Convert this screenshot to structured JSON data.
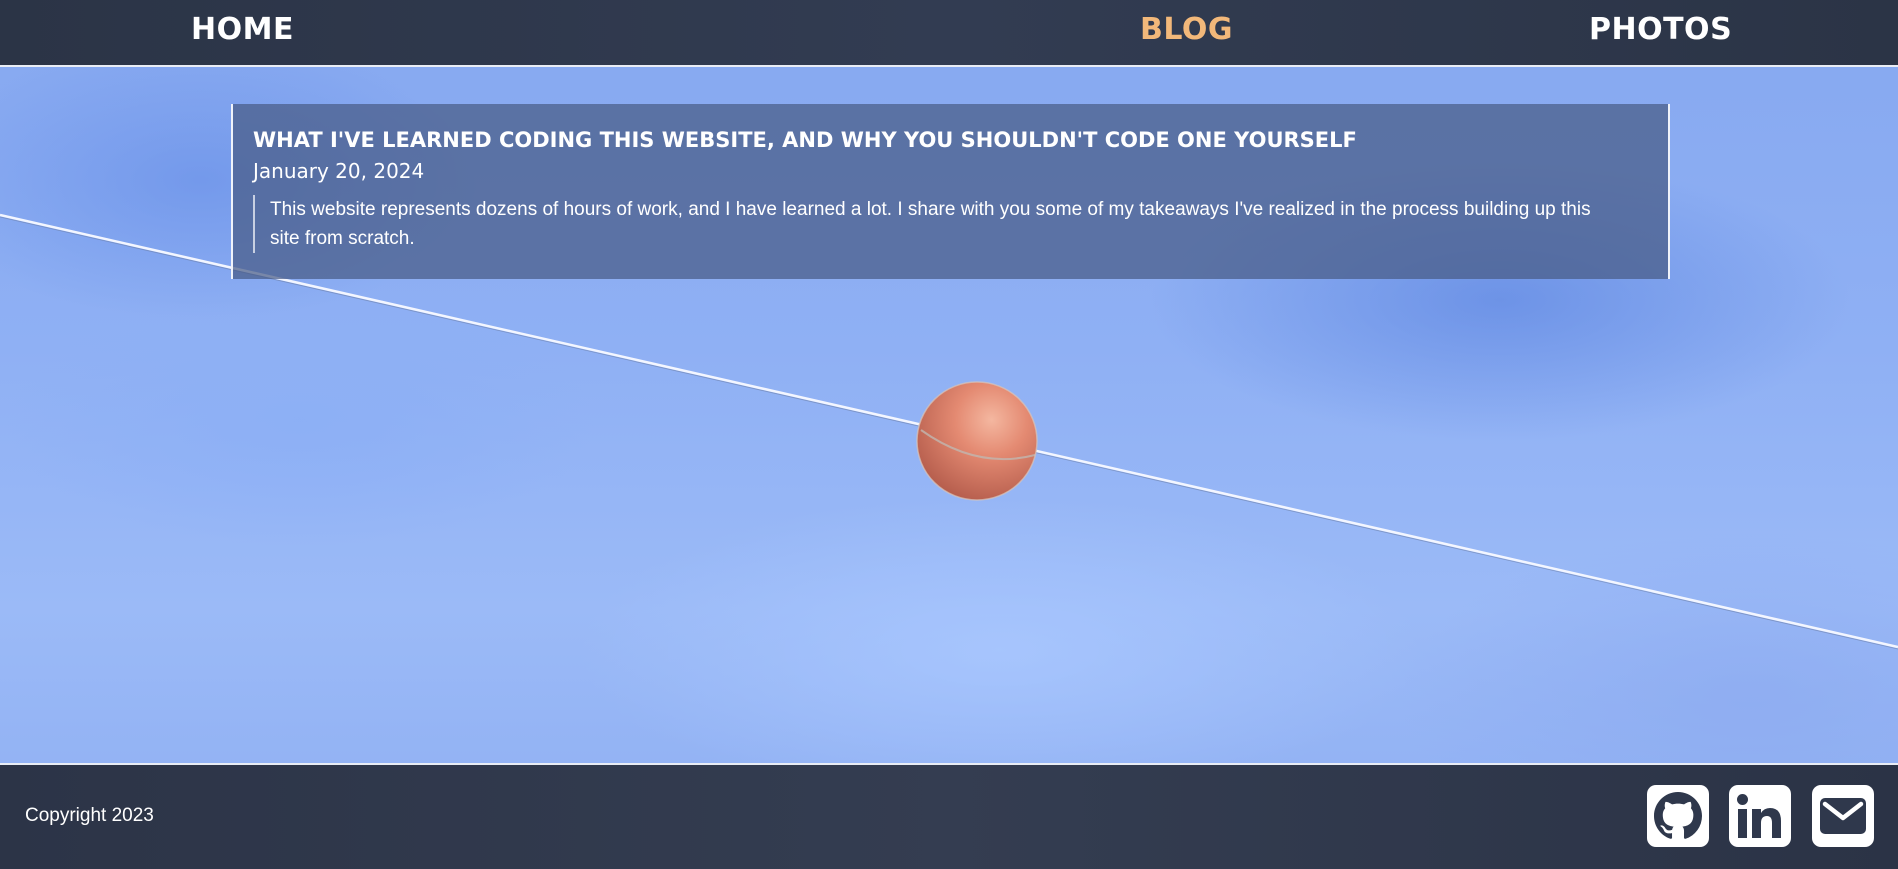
{
  "nav": {
    "home_label": "HOME",
    "blog_label": "BLOG",
    "photos_label": "PHOTOS",
    "active": "BLOG",
    "active_color": "#f2b87a"
  },
  "posts": [
    {
      "title": "WHAT I'VE LEARNED CODING THIS WEBSITE, AND WHY YOU SHOULDN'T CODE ONE YOURSELF",
      "date": "January 20, 2024",
      "excerpt": "This website represents dozens of hours of work, and I have learned a lot. I share with you some of my takeaways I've realized in the process building up this site from scratch."
    }
  ],
  "footer": {
    "copyright": "Copyright 2023",
    "social": [
      {
        "icon": "github-icon"
      },
      {
        "icon": "linkedin-icon"
      },
      {
        "icon": "email-icon"
      }
    ]
  },
  "colors": {
    "nav_bg": "#2f384c",
    "sky": "#8fb0f4",
    "card_bg": "rgba(72, 92, 135, 0.72)"
  }
}
